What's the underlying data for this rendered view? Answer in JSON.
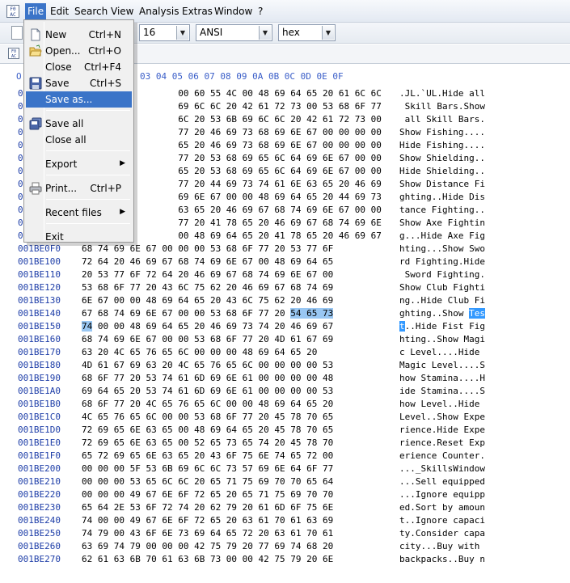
{
  "menubar": {
    "items": [
      "File",
      "Edit",
      "Search",
      "View",
      "Analysis",
      "Extras",
      "Window",
      "?"
    ]
  },
  "toolbar": {
    "bytes_per_row": "16",
    "charset": "ANSI",
    "display_mode": "hex"
  },
  "file_menu": {
    "items": [
      {
        "label": "New",
        "shortcut": "Ctrl+N",
        "icon": "new-document-icon"
      },
      {
        "label": "Open...",
        "shortcut": "Ctrl+O",
        "icon": "open-folder-icon"
      },
      {
        "label": "Close",
        "shortcut": "Ctrl+F4",
        "icon": ""
      },
      {
        "label": "Save",
        "shortcut": "Ctrl+S",
        "icon": "floppy-disk-icon"
      },
      {
        "label": "Save as...",
        "shortcut": "",
        "icon": ""
      },
      {
        "label": "Save all",
        "shortcut": "",
        "icon": "save-all-icon"
      },
      {
        "label": "Close all",
        "shortcut": "",
        "icon": ""
      },
      {
        "label": "Export",
        "shortcut": "",
        "icon": "",
        "submenu": true
      },
      {
        "label": "Print...",
        "shortcut": "Ctrl+P",
        "icon": "printer-icon"
      },
      {
        "label": "Recent files",
        "shortcut": "",
        "icon": "",
        "submenu": true
      },
      {
        "label": "Exit",
        "shortcut": "",
        "icon": ""
      }
    ],
    "highlighted": "Save as..."
  },
  "hex_header": {
    "offset_label": "O",
    "visible_columns": "03 04 05 06 07 08 09 0A 0B 0C 0D 0E 0F"
  },
  "hex_rows": [
    {
      "offset": "0",
      "hex": "                  00 60 55 4C 00 48 69 64 65 20 61 6C 6C",
      "ascii": ".JL.`UL.Hide all"
    },
    {
      "offset": "0",
      "hex": "                  69 6C 6C 20 42 61 72 73 00 53 68 6F 77",
      "ascii": " Skill Bars.Show"
    },
    {
      "offset": "0",
      "hex": "                  6C 20 53 6B 69 6C 6C 20 42 61 72 73 00",
      "ascii": " all Skill Bars."
    },
    {
      "offset": "0",
      "hex": "                  77 20 46 69 73 68 69 6E 67 00 00 00 00",
      "ascii": "Show Fishing...."
    },
    {
      "offset": "0",
      "hex": "                  65 20 46 69 73 68 69 6E 67 00 00 00 00",
      "ascii": "Hide Fishing...."
    },
    {
      "offset": "0",
      "hex": "                  77 20 53 68 69 65 6C 64 69 6E 67 00 00",
      "ascii": "Show Shielding.."
    },
    {
      "offset": "0",
      "hex": "                  65 20 53 68 69 65 6C 64 69 6E 67 00 00",
      "ascii": "Hide Shielding.."
    },
    {
      "offset": "0",
      "hex": "                  77 20 44 69 73 74 61 6E 63 65 20 46 69",
      "ascii": "Show Distance Fi"
    },
    {
      "offset": "0",
      "hex": "                  69 6E 67 00 00 48 69 64 65 20 44 69 73",
      "ascii": "ghting..Hide Dis"
    },
    {
      "offset": "0",
      "hex": "                  63 65 20 46 69 67 68 74 69 6E 67 00 00",
      "ascii": "tance Fighting.."
    },
    {
      "offset": "0",
      "hex": "                  77 20 41 78 65 20 46 69 67 68 74 69 6E",
      "ascii": "Show Axe Fightin"
    },
    {
      "offset": "0",
      "hex": "                  00 48 69 64 65 20 41 78 65 20 46 69 67",
      "ascii": "g...Hide Axe Fig"
    },
    {
      "offset": "001BE0F0",
      "hex": "68 74 69 6E 67 00 00 00 53 68 6F 77 20 53 77 6F",
      "ascii": "hting...Show Swo"
    },
    {
      "offset": "001BE100",
      "hex": "72 64 20 46 69 67 68 74 69 6E 67 00 48 69 64 65",
      "ascii": "rd Fighting.Hide"
    },
    {
      "offset": "001BE110",
      "hex": "20 53 77 6F 72 64 20 46 69 67 68 74 69 6E 67 00",
      "ascii": " Sword Fighting."
    },
    {
      "offset": "001BE120",
      "hex": "53 68 6F 77 20 43 6C 75 62 20 46 69 67 68 74 69",
      "ascii": "Show Club Fighti"
    },
    {
      "offset": "001BE130",
      "hex": "6E 67 00 00 48 69 64 65 20 43 6C 75 62 20 46 69",
      "ascii": "ng..Hide Club Fi"
    },
    {
      "offset": "001BE140",
      "hex": "67 68 74 69 6E 67 00 00 53 68 6F 77 20 54 65 73",
      "ascii": "ghting..Show Tes"
    },
    {
      "offset": "001BE150",
      "hex": "74 00 00 48 69 64 65 20 46 69 73 74 20 46 69 67",
      "ascii": "t..Hide Fist Fig"
    },
    {
      "offset": "001BE160",
      "hex": "68 74 69 6E 67 00 00 53 68 6F 77 20 4D 61 67 69",
      "ascii": "hting..Show Magi"
    },
    {
      "offset": "001BE170",
      "hex": "63 20 4C 65 76 65 6C 00 00 00 48 69 64 65 20",
      "ascii": "c Level....Hide "
    },
    {
      "offset": "001BE180",
      "hex": "4D 61 67 69 63 20 4C 65 76 65 6C 00 00 00 00 53",
      "ascii": "Magic Level....S"
    },
    {
      "offset": "001BE190",
      "hex": "68 6F 77 20 53 74 61 6D 69 6E 61 00 00 00 00 48",
      "ascii": "how Stamina....H"
    },
    {
      "offset": "001BE1A0",
      "hex": "69 64 65 20 53 74 61 6D 69 6E 61 00 00 00 00 53",
      "ascii": "ide Stamina....S"
    },
    {
      "offset": "001BE1B0",
      "hex": "68 6F 77 20 4C 65 76 65 6C 00 00 48 69 64 65 20",
      "ascii": "how Level..Hide "
    },
    {
      "offset": "001BE1C0",
      "hex": "4C 65 76 65 6C 00 00 53 68 6F 77 20 45 78 70 65",
      "ascii": "Level..Show Expe"
    },
    {
      "offset": "001BE1D0",
      "hex": "72 69 65 6E 63 65 00 48 69 64 65 20 45 78 70 65",
      "ascii": "rience.Hide Expe"
    },
    {
      "offset": "001BE1E0",
      "hex": "72 69 65 6E 63 65 00 52 65 73 65 74 20 45 78 70",
      "ascii": "rience.Reset Exp"
    },
    {
      "offset": "001BE1F0",
      "hex": "65 72 69 65 6E 63 65 20 43 6F 75 6E 74 65 72 00",
      "ascii": "erience Counter."
    },
    {
      "offset": "001BE200",
      "hex": "00 00 00 5F 53 6B 69 6C 6C 73 57 69 6E 64 6F 77",
      "ascii": "..._SkillsWindow"
    },
    {
      "offset": "001BE210",
      "hex": "00 00 00 53 65 6C 6C 20 65 71 75 69 70 70 65 64",
      "ascii": "...Sell equipped"
    },
    {
      "offset": "001BE220",
      "hex": "00 00 00 49 67 6E 6F 72 65 20 65 71 75 69 70 70",
      "ascii": "...Ignore equipp"
    },
    {
      "offset": "001BE230",
      "hex": "65 64 2E 53 6F 72 74 20 62 79 20 61 6D 6F 75 6E",
      "ascii": "ed.Sort by amoun"
    },
    {
      "offset": "001BE240",
      "hex": "74 00 00 49 67 6E 6F 72 65 20 63 61 70 61 63 69",
      "ascii": "t..Ignore capaci"
    },
    {
      "offset": "001BE250",
      "hex": "74 79 00 43 6F 6E 73 69 64 65 72 20 63 61 70 61",
      "ascii": "ty.Consider capa"
    },
    {
      "offset": "001BE260",
      "hex": "63 69 74 79 00 00 00 42 75 79 20 77 69 74 68 20",
      "ascii": "city...Buy with "
    },
    {
      "offset": "001BE270",
      "hex": "62 61 63 6B 70 61 63 6B 73 00 00 42 75 79 20 6E",
      "ascii": "backpacks..Buy n"
    }
  ],
  "selection": {
    "hex_start": "54 65 73",
    "hex_end": "74",
    "ascii_text": "Test"
  },
  "colors": {
    "offset": "#1e3ea8",
    "menu_highlight": "#3b74c8",
    "selection": "#3399ff"
  }
}
